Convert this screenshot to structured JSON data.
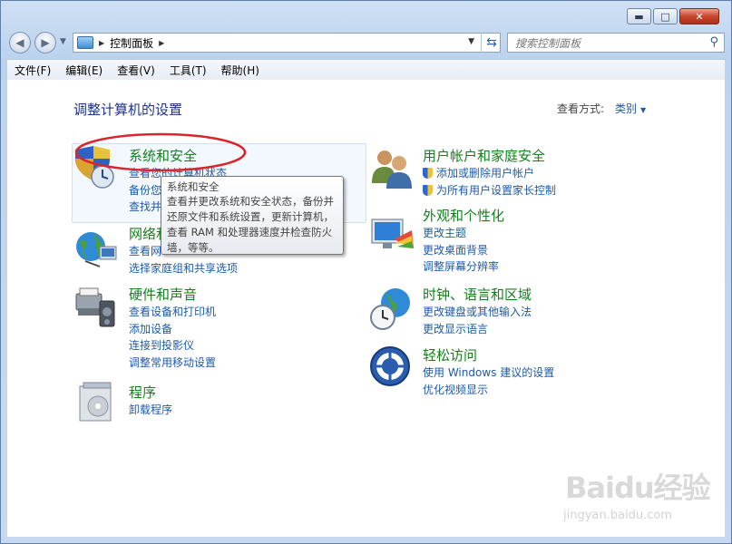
{
  "window": {
    "caption_buttons": {
      "minimize": "▬",
      "maximize": "□",
      "close": "✕"
    }
  },
  "nav": {
    "address_text": "控制面板",
    "search_placeholder": "搜索控制面板"
  },
  "menubar": {
    "items": [
      "文件(F)",
      "编辑(E)",
      "查看(V)",
      "工具(T)",
      "帮助(H)"
    ]
  },
  "main": {
    "heading": "调整计算机的设置",
    "view_by_label": "查看方式:",
    "view_by_value": "类别"
  },
  "categories": [
    {
      "title": "系统和安全",
      "links": [
        "查看您的计算机状态",
        "备份您",
        "查找并"
      ],
      "icon": "system-security-icon"
    },
    {
      "title": "网络和",
      "links": [
        "查看网",
        "选择家庭组和共享选项"
      ],
      "icon": "network-icon"
    },
    {
      "title": "硬件和声音",
      "links": [
        "查看设备和打印机",
        "添加设备",
        "连接到投影仪",
        "调整常用移动设置"
      ],
      "icon": "hardware-sound-icon"
    },
    {
      "title": "程序",
      "links": [
        "卸载程序"
      ],
      "icon": "programs-icon"
    },
    {
      "title": "用户帐户和家庭安全",
      "links": [
        "添加或删除用户帐户",
        "为所有用户设置家长控制"
      ],
      "icon": "user-accounts-icon"
    },
    {
      "title": "外观和个性化",
      "links": [
        "更改主题",
        "更改桌面背景",
        "调整屏幕分辨率"
      ],
      "icon": "appearance-icon"
    },
    {
      "title": "时钟、语言和区域",
      "links": [
        "更改键盘或其他输入法",
        "更改显示语言"
      ],
      "icon": "clock-region-icon"
    },
    {
      "title": "轻松访问",
      "links": [
        "使用 Windows 建议的设置",
        "优化视频显示"
      ],
      "icon": "ease-of-access-icon"
    }
  ],
  "tooltip": {
    "title": "系统和安全",
    "body": "查看并更改系统和安全状态，备份并还原文件和系统设置，更新计算机，查看 RAM 和处理器速度并检查防火墙，等等。"
  },
  "watermark": {
    "brand": "Baidu经验",
    "url": "jingyan.baidu.com"
  },
  "colors": {
    "category_title": "#13801b",
    "link": "#1e5aa8",
    "heading": "#1e3287",
    "annotation": "#d9262c"
  }
}
